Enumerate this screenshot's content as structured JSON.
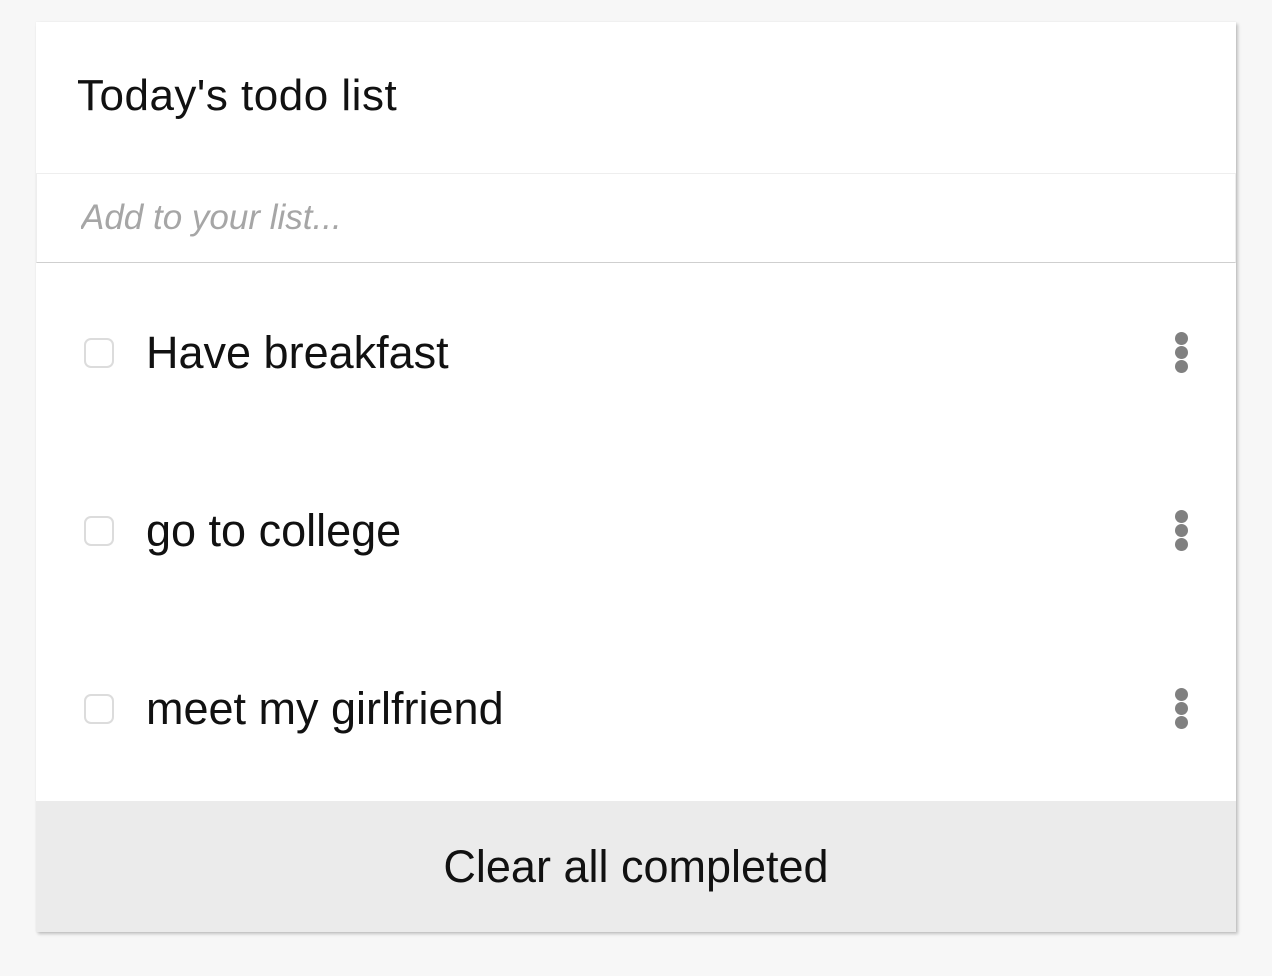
{
  "header": {
    "title": "Today's todo list"
  },
  "add_input": {
    "value": "",
    "placeholder": "Add to your list..."
  },
  "todos": [
    {
      "label": "Have breakfast",
      "checked": false,
      "menu_icon": "more-vertical-icon"
    },
    {
      "label": "go to college",
      "checked": false,
      "menu_icon": "more-vertical-icon"
    },
    {
      "label": "meet my girlfriend",
      "checked": false,
      "menu_icon": "more-vertical-icon"
    }
  ],
  "footer": {
    "clear_label": "Clear all completed"
  },
  "colors": {
    "background": "#f7f7f7",
    "card": "#ffffff",
    "footer_bg": "#ebebeb",
    "placeholder": "#a6a6a6",
    "icon": "#808080",
    "text": "#111111"
  }
}
